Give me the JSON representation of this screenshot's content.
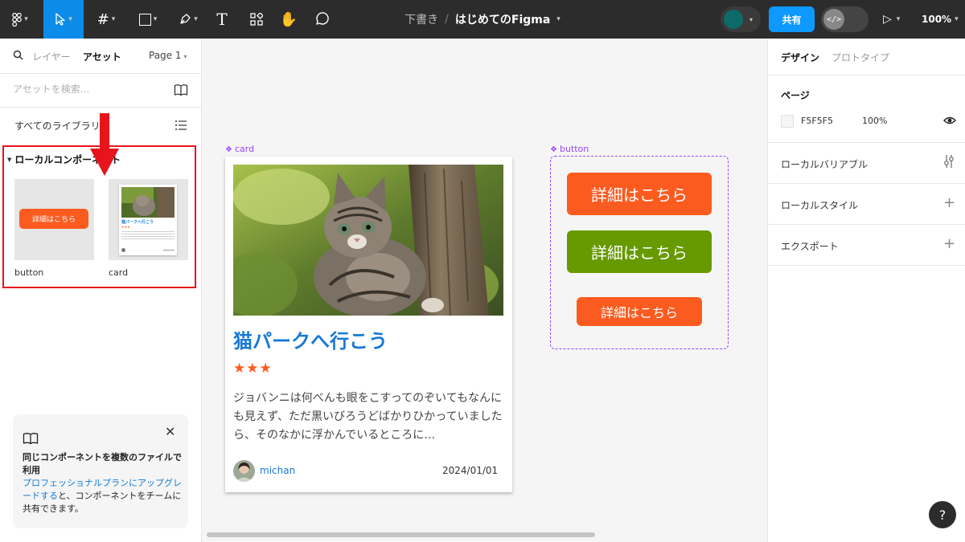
{
  "toolbar": {
    "figma_menu_label": "F",
    "breadcrumb_draft": "下書き",
    "breadcrumb_sep": "/",
    "file_name": "はじめてのFigma",
    "share_label": "共有",
    "dev_mode_label": "</>",
    "zoom_label": "100%",
    "active_tool": "move",
    "accent_color": "#0c8ce9"
  },
  "left_panel": {
    "tab_layers": "レイヤー",
    "tab_assets": "アセット",
    "page_select": "Page 1",
    "search_placeholder": "アセットを検索...",
    "all_libraries": "すべてのライブラリ",
    "local_components_title": "ローカルコンポーネント",
    "components": [
      {
        "name": "button",
        "preview_text": "詳細はこちら"
      },
      {
        "name": "card",
        "preview_title": "猫パークへ行こう",
        "preview_stars": "★★★"
      }
    ],
    "tip": {
      "title": "同じコンポーネントを複数のファイルで利用",
      "link_text": "プロフェッショナルプランにアップグレードする",
      "body_text": "と、コンポーネントをチームに共有できます。",
      "close_icon": "close-icon"
    }
  },
  "canvas": {
    "card_frame_label": "card",
    "button_frame_label": "button",
    "card": {
      "title": "猫パークへ行こう",
      "stars": "★★★",
      "text": "ジョバンニは何べんも眼をこすってのぞいてもなんにも見えず、ただ黒いびろうどばかりひかっていましたら、そのなかに浮かんでいるところに…",
      "author": "michan",
      "date": "2024/01/01"
    },
    "buttons": [
      {
        "label": "詳細はこちら",
        "color": "#fc5b20"
      },
      {
        "label": "詳細はこちら",
        "color": "#679a00"
      },
      {
        "label": "詳細はこちら",
        "color": "#fc5b20"
      }
    ]
  },
  "right_panel": {
    "tab_design": "デザイン",
    "tab_prototype": "プロトタイプ",
    "page_section_title": "ページ",
    "page_color_hex": "F5F5F5",
    "page_color_opacity": "100%",
    "local_variables": "ローカルバリアブル",
    "local_styles": "ローカルスタイル",
    "export": "エクスポート"
  },
  "colors": {
    "component_purple": "#9747ff",
    "highlight_red": "#e8141b",
    "title_blue": "#1779d6"
  }
}
